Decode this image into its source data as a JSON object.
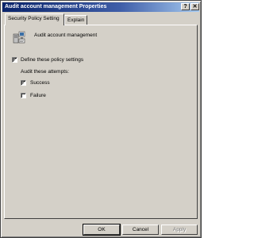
{
  "window": {
    "title": "Audit account management Properties",
    "help_glyph": "?",
    "close_glyph": "✕"
  },
  "tabs": [
    {
      "label": "Security Policy Setting",
      "active": true
    },
    {
      "label": "Explain",
      "active": false
    }
  ],
  "policy": {
    "icon": "policy-computer-icon",
    "name": "Audit account management"
  },
  "define": {
    "label": "Define these policy settings",
    "checked": true
  },
  "audit": {
    "heading": "Audit these attempts:",
    "success": {
      "label": "Success",
      "checked": true
    },
    "failure": {
      "label": "Failure",
      "checked": false
    }
  },
  "buttons": {
    "ok": "OK",
    "cancel": "Cancel",
    "apply": "Apply"
  },
  "check_glyph": "✓"
}
